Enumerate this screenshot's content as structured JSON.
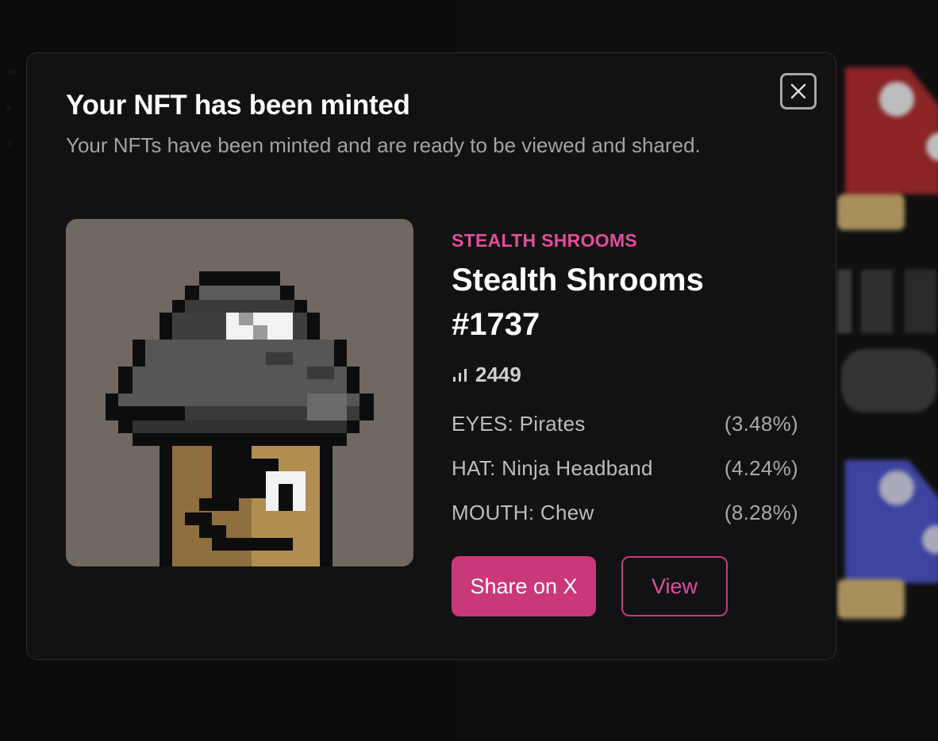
{
  "modal": {
    "title": "Your NFT has been minted",
    "subtitle": "Your NFTs have been minted and are ready to be viewed and shared.",
    "close_icon": "close-icon"
  },
  "nft": {
    "collection": "STEALTH SHROOMS",
    "name": "Stealth Shrooms #1737",
    "rank_icon": "signal-bars-icon",
    "rank": "2449",
    "traits": [
      {
        "label": "EYES: Pirates",
        "percent": "(3.48%)"
      },
      {
        "label": "HAT: Ninja Headband",
        "percent": "(4.24%)"
      },
      {
        "label": "MOUTH: Chew",
        "percent": "(8.28%)"
      }
    ]
  },
  "actions": {
    "share_label": "Share on X",
    "view_label": "View"
  },
  "colors": {
    "accent": "#c9397a",
    "accent_text": "#e04f9a",
    "modal_bg": "#121214",
    "art_bg": "#6f6860"
  }
}
